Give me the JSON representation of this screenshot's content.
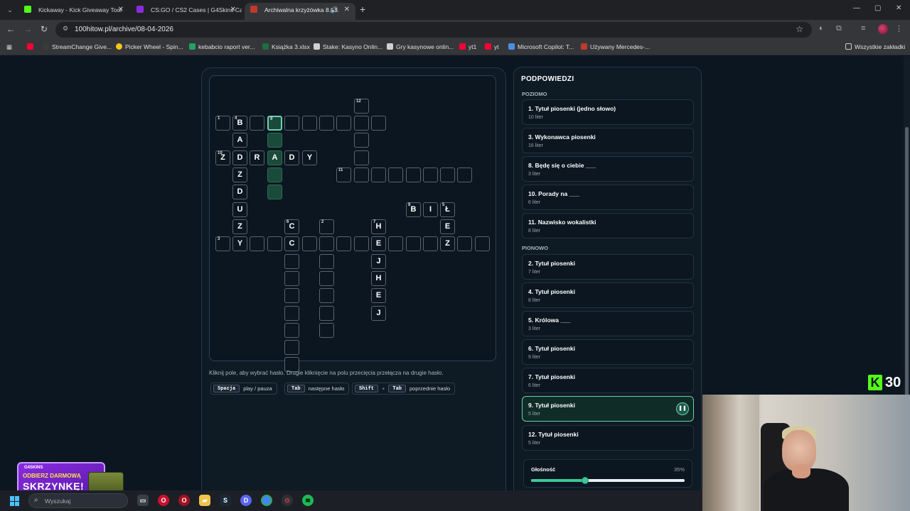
{
  "browser": {
    "tabs": [
      {
        "title": "Kickaway - Kick Giveaway Tool",
        "color": "#53fc18"
      },
      {
        "title": "CS:GO / CS2 Cases | G4Skins Ca",
        "color": "#8a2be2"
      },
      {
        "title": "Archiwalna krzyżówka 8.04.",
        "color": "#c0392b"
      }
    ],
    "url": "100hitow.pl/archive/08-04-2026",
    "bookmarks": [
      {
        "label": "",
        "color": "#ff0033"
      },
      {
        "label": "StreamChange Give...",
        "color": "#3a3a3a"
      },
      {
        "label": "Picker Wheel - Spin...",
        "color": "#f5c518"
      },
      {
        "label": "kebabcio raport ver...",
        "color": "#1fa463"
      },
      {
        "label": "Książka 3.xlsx",
        "color": "#1d6f42"
      },
      {
        "label": "Stake: Kasyno Onlin...",
        "color": "#d0d0d0"
      },
      {
        "label": "Gry kasynowe onlin...",
        "color": "#d0d0d0"
      },
      {
        "label": "yt1",
        "color": "#ff0033"
      },
      {
        "label": "yt",
        "color": "#ff0033"
      },
      {
        "label": "Microsoft Copilot: T...",
        "color": "#4a90e2"
      },
      {
        "label": "Używany Mercedes-...",
        "color": "#c0392b"
      }
    ],
    "all_bookmarks": "Wszystkie zakładki"
  },
  "crossword": {
    "cells": [
      {
        "n": "12",
        "l": ""
      },
      {
        "n": "1",
        "l": ""
      },
      {
        "n": "4",
        "l": "B"
      },
      {
        "n": "",
        "l": ""
      },
      {
        "n": "9",
        "l": ""
      },
      {
        "n": "",
        "l": ""
      },
      {
        "n": "",
        "l": ""
      },
      {
        "n": "",
        "l": ""
      },
      {
        "n": "",
        "l": ""
      },
      {
        "n": "",
        "l": ""
      },
      {
        "n": "",
        "l": ""
      },
      {
        "n": "",
        "l": "A"
      },
      {
        "n": "",
        "l": ""
      },
      {
        "n": "",
        "l": ""
      },
      {
        "n": "10",
        "l": "Z"
      },
      {
        "n": "",
        "l": "D"
      },
      {
        "n": "",
        "l": "R"
      },
      {
        "n": "",
        "l": "A"
      },
      {
        "n": "",
        "l": "D"
      },
      {
        "n": "",
        "l": "Y"
      },
      {
        "n": "",
        "l": ""
      },
      {
        "n": "",
        "l": "Z"
      },
      {
        "n": "",
        "l": ""
      },
      {
        "n": "11",
        "l": ""
      },
      {
        "n": "",
        "l": ""
      },
      {
        "n": "",
        "l": ""
      },
      {
        "n": "",
        "l": ""
      },
      {
        "n": "",
        "l": ""
      },
      {
        "n": "",
        "l": ""
      },
      {
        "n": "",
        "l": ""
      },
      {
        "n": "",
        "l": ""
      },
      {
        "n": "",
        "l": "D"
      },
      {
        "n": "",
        "l": ""
      },
      {
        "n": "",
        "l": "U"
      },
      {
        "n": "8",
        "l": "B"
      },
      {
        "n": "",
        "l": "I"
      },
      {
        "n": "5",
        "l": "Ł"
      },
      {
        "n": "",
        "l": "Z"
      },
      {
        "n": "6",
        "l": "C"
      },
      {
        "n": "2",
        "l": ""
      },
      {
        "n": "7",
        "l": "H"
      },
      {
        "n": "",
        "l": "E"
      },
      {
        "n": "3",
        "l": ""
      },
      {
        "n": "",
        "l": "Y"
      },
      {
        "n": "",
        "l": ""
      },
      {
        "n": "",
        "l": ""
      },
      {
        "n": "",
        "l": "C"
      },
      {
        "n": "",
        "l": ""
      },
      {
        "n": "",
        "l": ""
      },
      {
        "n": "",
        "l": ""
      },
      {
        "n": "",
        "l": ""
      },
      {
        "n": "",
        "l": "E"
      },
      {
        "n": "",
        "l": ""
      },
      {
        "n": "",
        "l": ""
      },
      {
        "n": "",
        "l": ""
      },
      {
        "n": "",
        "l": "Z"
      },
      {
        "n": "",
        "l": ""
      },
      {
        "n": "",
        "l": ""
      },
      {
        "n": "",
        "l": ""
      },
      {
        "n": "",
        "l": ""
      },
      {
        "n": "",
        "l": "J"
      },
      {
        "n": "",
        "l": ""
      },
      {
        "n": "",
        "l": ""
      },
      {
        "n": "",
        "l": "H"
      },
      {
        "n": "",
        "l": ""
      },
      {
        "n": "",
        "l": ""
      },
      {
        "n": "",
        "l": "E"
      },
      {
        "n": "",
        "l": ""
      },
      {
        "n": "",
        "l": ""
      },
      {
        "n": "",
        "l": "J"
      },
      {
        "n": "",
        "l": ""
      },
      {
        "n": "",
        "l": ""
      },
      {
        "n": "",
        "l": ""
      },
      {
        "n": "",
        "l": ""
      }
    ],
    "hint": "Kliknij pole, aby wybrać hasło. Drugie kliknięcie na polu przecięcia przełącza na drugie hasło.",
    "shortcuts": [
      {
        "keys": [
          "Spacja"
        ],
        "action": "play / pauza"
      },
      {
        "keys": [
          "Tab"
        ],
        "action": "następne hasło"
      },
      {
        "keys": [
          "Shift",
          "Tab"
        ],
        "action": "poprzednie hasło"
      }
    ]
  },
  "clues": {
    "title": "PODPOWIEDZI",
    "across_label": "POZIOMO",
    "down_label": "PIONOWO",
    "across": [
      {
        "text": "1. Tytuł piosenki (jedno słowo)",
        "len": "10 liter"
      },
      {
        "text": "3. Wykonawca piosenki",
        "len": "16 liter"
      },
      {
        "text": "8. Będę się o ciebie ___",
        "len": "3 liter"
      },
      {
        "text": "10. Porady na ___",
        "len": "6 liter"
      },
      {
        "text": "11. Nazwisko wokalistki",
        "len": "8 liter"
      }
    ],
    "down": [
      {
        "text": "2. Tytuł piosenki",
        "len": "7 liter"
      },
      {
        "text": "4. Tytuł piosenki",
        "len": "8 liter"
      },
      {
        "text": "5. Królowa ___",
        "len": "3 liter"
      },
      {
        "text": "6. Tytuł piosenki",
        "len": "9 liter"
      },
      {
        "text": "7. Tytuł piosenki",
        "len": "6 liter"
      },
      {
        "text": "9. Tytuł piosenki",
        "len": "5 liter"
      },
      {
        "text": "12. Tytuł piosenki",
        "len": "5 liter"
      }
    ],
    "active_index": 5,
    "volume_label": "Głośność",
    "volume_text": "35%",
    "volume_fraction": 0.35
  },
  "overlays": {
    "kick_count": "30",
    "kick_letter": "K",
    "promo_brand": "G4SKINS",
    "promo_line": "ODBIERZ DARMOWĄ",
    "promo_big": "SKRZYNKĘ!"
  },
  "taskbar": {
    "search_placeholder": "Wyszukaj"
  },
  "colors": {
    "accent": "#6fcfb0",
    "highlight_cell": "#1a4a3a",
    "kick_green": "#53fc18",
    "volume": "#3ec79a"
  }
}
